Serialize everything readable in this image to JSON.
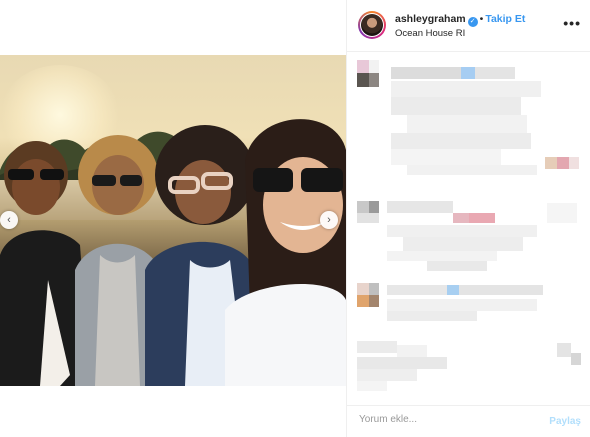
{
  "post": {
    "username": "ashleygraham",
    "verified": true,
    "separator": "•",
    "follow_label": "Takip Et",
    "location": "Ocean House RI",
    "more_glyph": "•••"
  },
  "carousel": {
    "prev_glyph": "‹",
    "next_glyph": "›"
  },
  "comment_box": {
    "placeholder": "Yorum ekle...",
    "post_label": "Paylaş"
  },
  "colors": {
    "accent": "#3897f0",
    "post_disabled": "#b2dffc",
    "divider": "#efefef"
  }
}
